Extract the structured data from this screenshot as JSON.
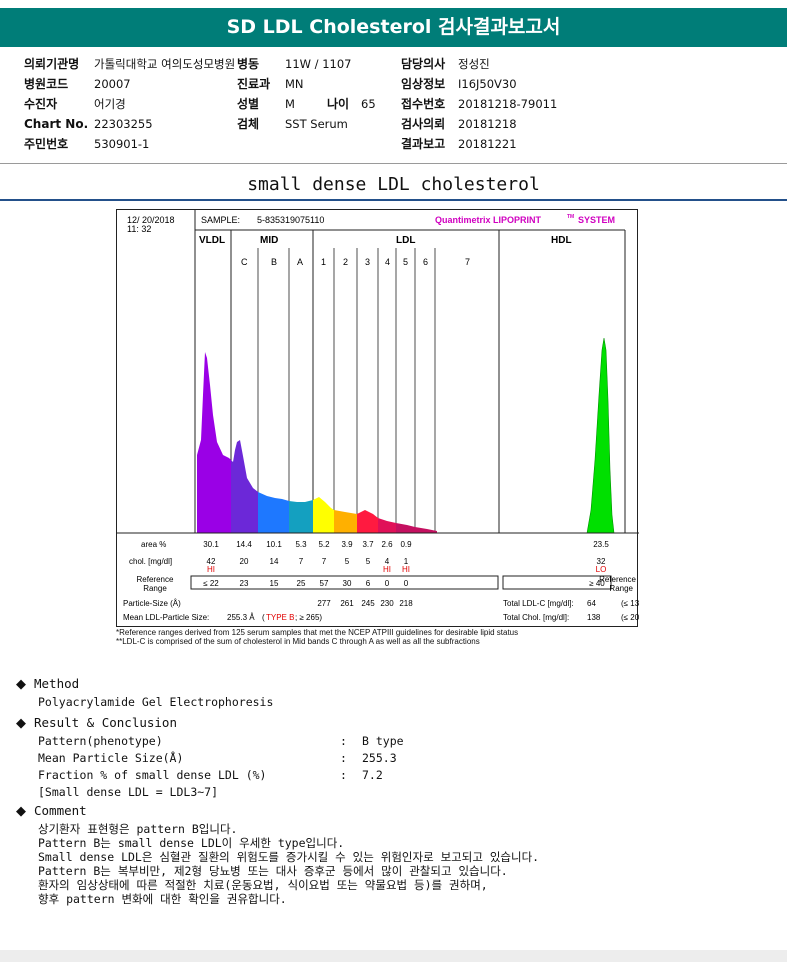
{
  "report_title": "SD LDL Cholesterol 검사결과보고서",
  "info": {
    "institution_label": "의뢰기관명",
    "institution_value": "가톨릭대학교 여의도성모병원",
    "ward_label": "병동",
    "ward_value": "11W / 1107",
    "doctor_label": "담당의사",
    "doctor_value": "정성진",
    "hospital_code_label": "병원코드",
    "hospital_code_value": "20007",
    "dept_label": "진료과",
    "dept_value": "MN",
    "clinical_label": "임상정보",
    "clinical_value": "I16J50V30",
    "patient_label": "수진자",
    "patient_value": "어기경",
    "sex_label": "성별",
    "sex_value": "M",
    "age_label": "나이",
    "age_value": "65",
    "receipt_label": "접수번호",
    "receipt_value": "20181218-79011",
    "chart_label": "Chart No.",
    "chart_value": "22303255",
    "specimen_label": "검체",
    "specimen_value": "SST Serum",
    "request_label": "검사의뢰",
    "request_value": "20181218",
    "id_label": "주민번호",
    "id_value": "530901-1",
    "result_label": "결과보고",
    "result_value": "20181221"
  },
  "section_title": "small dense LDL cholesterol",
  "chart": {
    "date": "12/ 20/2018",
    "time": "11: 32",
    "sample_label": "SAMPLE:",
    "sample_value": "5-835319075110",
    "brand": "Quantimetrix LIPOPRINT",
    "brand_tm": "TM",
    "brand_suffix": "SYSTEM",
    "groups": [
      "VLDL",
      "MID",
      "LDL",
      "HDL"
    ],
    "sub_bands": [
      "C",
      "B",
      "A",
      "1",
      "2",
      "3",
      "4",
      "5",
      "6",
      "7"
    ],
    "area_label": "area %",
    "chol_label": "chol. [mg/dl]",
    "ref_label_1": "Reference",
    "ref_label_2": "Range",
    "particle_label": "Particle-Size (Å)",
    "mean_label": "Mean LDL-Particle Size:",
    "mean_value": "255.3 Å",
    "mean_type_open": "(",
    "mean_type": "TYPE B",
    "mean_type_close": "; ≥ 265)",
    "total_ldl_label": "Total LDL-C [mg/dl]:",
    "total_ldl_value": "64",
    "total_ldl_ref": "(≤ 130)",
    "total_chol_label": "Total Chol. [mg/dl]:",
    "total_chol_value": "138",
    "total_chol_ref": "(≤ 200)",
    "ref_range_vldl": "≤ 22",
    "ref_range_hdl": "≥ 40"
  },
  "chart_data": {
    "type": "table",
    "columns": [
      "VLDL",
      "C",
      "B",
      "A",
      "1",
      "2",
      "3",
      "4",
      "5",
      "6",
      "7",
      "HDL"
    ],
    "area_pct": [
      "30.1",
      "14.4",
      "10.1",
      "5.3",
      "5.2",
      "3.9",
      "3.7",
      "2.6",
      "0.9",
      "",
      "",
      "23.5"
    ],
    "chol_mg_dl": [
      "42",
      "20",
      "14",
      "7",
      "7",
      "5",
      "5",
      "4",
      "1",
      "",
      "",
      "32"
    ],
    "flags": [
      "HI",
      "",
      "",
      "",
      "",
      "",
      "",
      "HI",
      "HI",
      "",
      "",
      "LO"
    ],
    "reference_range": [
      "≤ 22",
      "23",
      "15",
      "25",
      "57",
      "30",
      "6",
      "0",
      "0",
      "",
      "",
      "≥ 40"
    ],
    "particle_size": [
      "",
      "",
      "",
      "",
      "277",
      "261",
      "245",
      "230",
      "218",
      "",
      "",
      ""
    ],
    "colors": {
      "vldl": "#9a00e6",
      "mid_c": "#7a2ce0",
      "mid_b": "#1e78ff",
      "mid_a": "#18b0c8",
      "ldl1": "#ffff00",
      "ldl2": "#ffb000",
      "ldl3": "#ff1a40",
      "ldl4": "#e0105a",
      "ldl5": "#d01060",
      "hdl": "#00e000"
    }
  },
  "footnotes": [
    "*Reference ranges derived from 125 serum samples that met the NCEP ATPIII guidelines for desirable lipid status",
    "**LDL-C is comprised of the sum of cholesterol in Mid bands C through A as well as all the subfractions"
  ],
  "method": {
    "heading": "Method",
    "text": "Polyacrylamide Gel Electrophoresis"
  },
  "result": {
    "heading": "Result & Conclusion",
    "rows": [
      {
        "label": "Pattern(phenotype)",
        "sep": ":",
        "value": "B type"
      },
      {
        "label": "Mean Particle Size(Å)",
        "sep": ":",
        "value": "255.3"
      },
      {
        "label": "Fraction % of small dense LDL (%)",
        "sep": ":",
        "value": "7.2"
      }
    ],
    "note": "[Small dense LDL = LDL3~7]"
  },
  "comment": {
    "heading": "Comment",
    "lines": [
      "상기환자 표현형은 pattern B입니다.",
      "Pattern B는 small dense LDL이 우세한 type입니다.",
      "Small dense LDL은 심혈관 질환의 위험도를 증가시킬 수 있는 위험인자로 보고되고 있습니다.",
      "Pattern B는 복부비만, 제2형 당뇨병 또는 대사 증후군 등에서 많이 관찰되고 있습니다.",
      "환자의 임상상태에 따른 적절한 치료(운동요법, 식이요법 또는 약물요법 등)를 권하며,",
      "향후 pattern 변화에 대한 확인을 권유합니다."
    ]
  }
}
